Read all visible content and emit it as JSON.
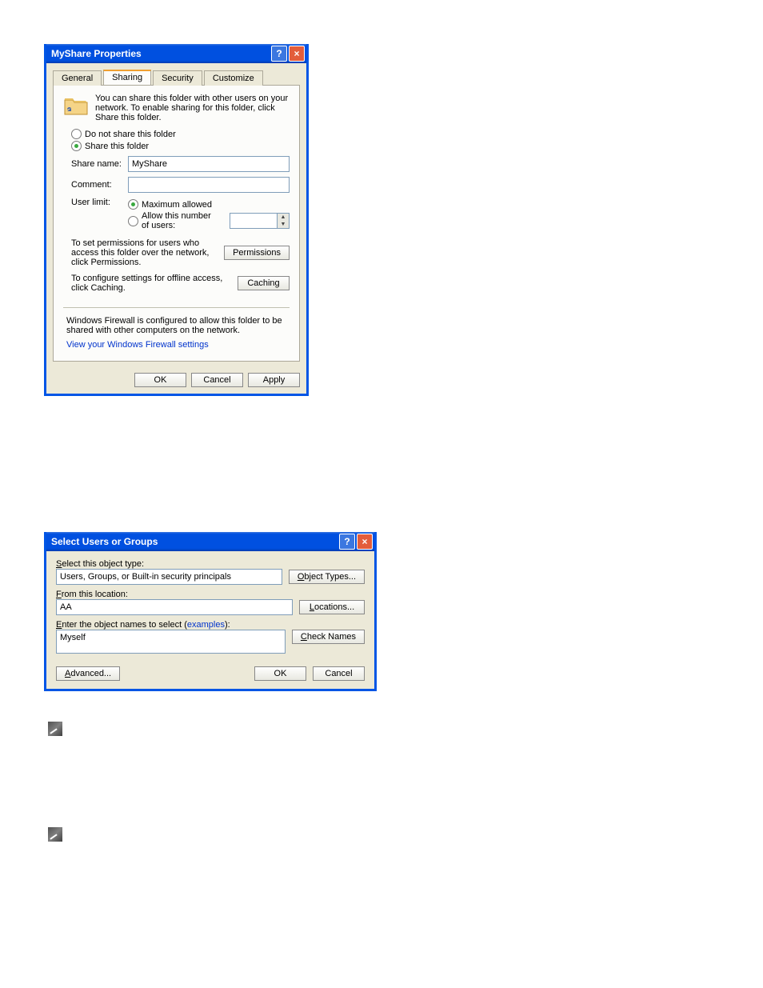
{
  "d1": {
    "title": "MyShare Properties",
    "tabs": {
      "general": "General",
      "sharing": "Sharing",
      "security": "Security",
      "customize": "Customize"
    },
    "intro": "You can share this folder with other users on your network. To enable sharing for this folder, click Share this folder.",
    "radio_noshare": "Do not share this folder",
    "radio_share": "Share this folder",
    "share_name_label": "Share name:",
    "share_name_value": "MyShare",
    "comment_label": "Comment:",
    "comment_value": "",
    "user_limit_label": "User limit:",
    "radio_max": "Maximum allowed",
    "radio_allow": "Allow this number of users:",
    "perm_text": "To set permissions for users who access this folder over the network, click Permissions.",
    "perm_btn": "Permissions",
    "cache_text": "To configure settings for offline access, click Caching.",
    "cache_btn": "Caching",
    "fw_text": "Windows Firewall is configured to allow this folder to be shared with other computers on the network.",
    "fw_link": "View your Windows Firewall settings",
    "ok": "OK",
    "cancel": "Cancel",
    "apply": "Apply"
  },
  "d2": {
    "title": "Select Users or Groups",
    "obj_type_label": "Select this object type:",
    "obj_type_value": "Users, Groups, or Built-in security principals",
    "obj_type_btn": "Object Types...",
    "loc_label": "From this location:",
    "loc_value": "AA",
    "loc_btn": "Locations...",
    "names_label_pre": "Enter the object names to select (",
    "names_label_link": "examples",
    "names_label_post": "):",
    "names_value": "Myself",
    "check_btn": "Check Names",
    "advanced": "Advanced...",
    "ok": "OK",
    "cancel": "Cancel"
  }
}
